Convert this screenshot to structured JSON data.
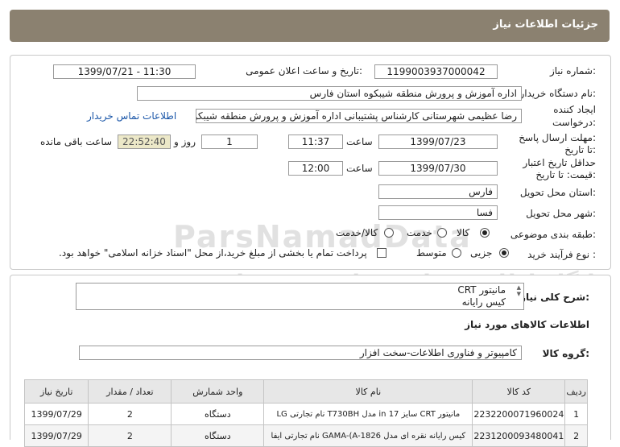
{
  "header": {
    "title": "جزئیات اطلاعات نیاز"
  },
  "form": {
    "need_number_label": "شماره نیاز:",
    "need_number": "1199003937000042",
    "announce_label": "تاریخ و ساعت اعلان عمومی:",
    "announce_value": "1399/07/21 - 11:30",
    "buyer_label": "نام دستگاه خریدار:",
    "buyer_value": "اداره آموزش و پرورش منطقه شیبکوه استان فارس",
    "creator_label_1": "ایجاد کننده",
    "creator_label_2": "درخواست:",
    "creator_value": "رضا عظیمی شهرستانی کارشناس پشتیبانی اداره آموزش و پرورش منطقه شیبکوه",
    "contact_link": "اطلاعات تماس خریدار",
    "deadline_label_1": "مهلت ارسال پاسخ:",
    "deadline_label_2": "تا تاریخ:",
    "deadline_date": "1399/07/23",
    "time_label": "ساعت",
    "deadline_time": "11:37",
    "days_value": "1",
    "days_label": "روز و",
    "remaining_time": "22:52:40",
    "remaining_label": "ساعت باقی مانده",
    "validity_label_1": "حداقل تاریخ اعتبار",
    "validity_label_2": "قیمت: تا تاریخ:",
    "validity_date": "1399/07/30",
    "validity_time_label": "ساعت",
    "validity_time": "12:00",
    "province_label": "استان محل تحویل:",
    "province_value": "فارس",
    "city_label": "شهر محل تحویل:",
    "city_value": "فسا",
    "category_label": "طبقه بندی موضوعی:",
    "cat_goods": "کالا",
    "cat_service": "خدمت",
    "cat_both": "کالا/خدمت",
    "purchase_label": "نوع فرآیند خرید :",
    "proc_partial": "جزیی",
    "proc_medium": "متوسط",
    "payment_note": "پرداخت تمام یا بخشی از مبلغ خرید،از محل \"اسناد خزانه اسلامی\" خواهد بود."
  },
  "summary": {
    "label": "شرح کلی نیاز:",
    "line1": "مانیتور CRT",
    "line2": "کیس رایانه"
  },
  "goods": {
    "section_title": "اطلاعات کالاهای مورد نیاز",
    "group_label": "گروه کالا:",
    "group_value": "کامپیوتر و فناوری اطلاعات-سخت افزار"
  },
  "watermark": {
    "brand": "ParsNamadData",
    "line1": "پایگاه اطلاع رسانی مناقصه و مزایده",
    "phone": "۰۲۱-۸۸۳۴۹۶۷۰-۵"
  },
  "table": {
    "headers": [
      "ردیف",
      "کد کالا",
      "نام کالا",
      "واحد شمارش",
      "تعداد / مقدار",
      "تاریخ نیاز"
    ],
    "rows": [
      [
        "1",
        "2232200071960024",
        "مانیتور CRT سایز 17 in مدل T730BH نام تجارتی LG",
        "دستگاه",
        "2",
        "1399/07/29"
      ],
      [
        "2",
        "2231200093480041",
        "کیس رایانه نقره ای مدل GAMA-(A-1826 نام تجارتی ایفا",
        "دستگاه",
        "2",
        "1399/07/29"
      ]
    ]
  }
}
